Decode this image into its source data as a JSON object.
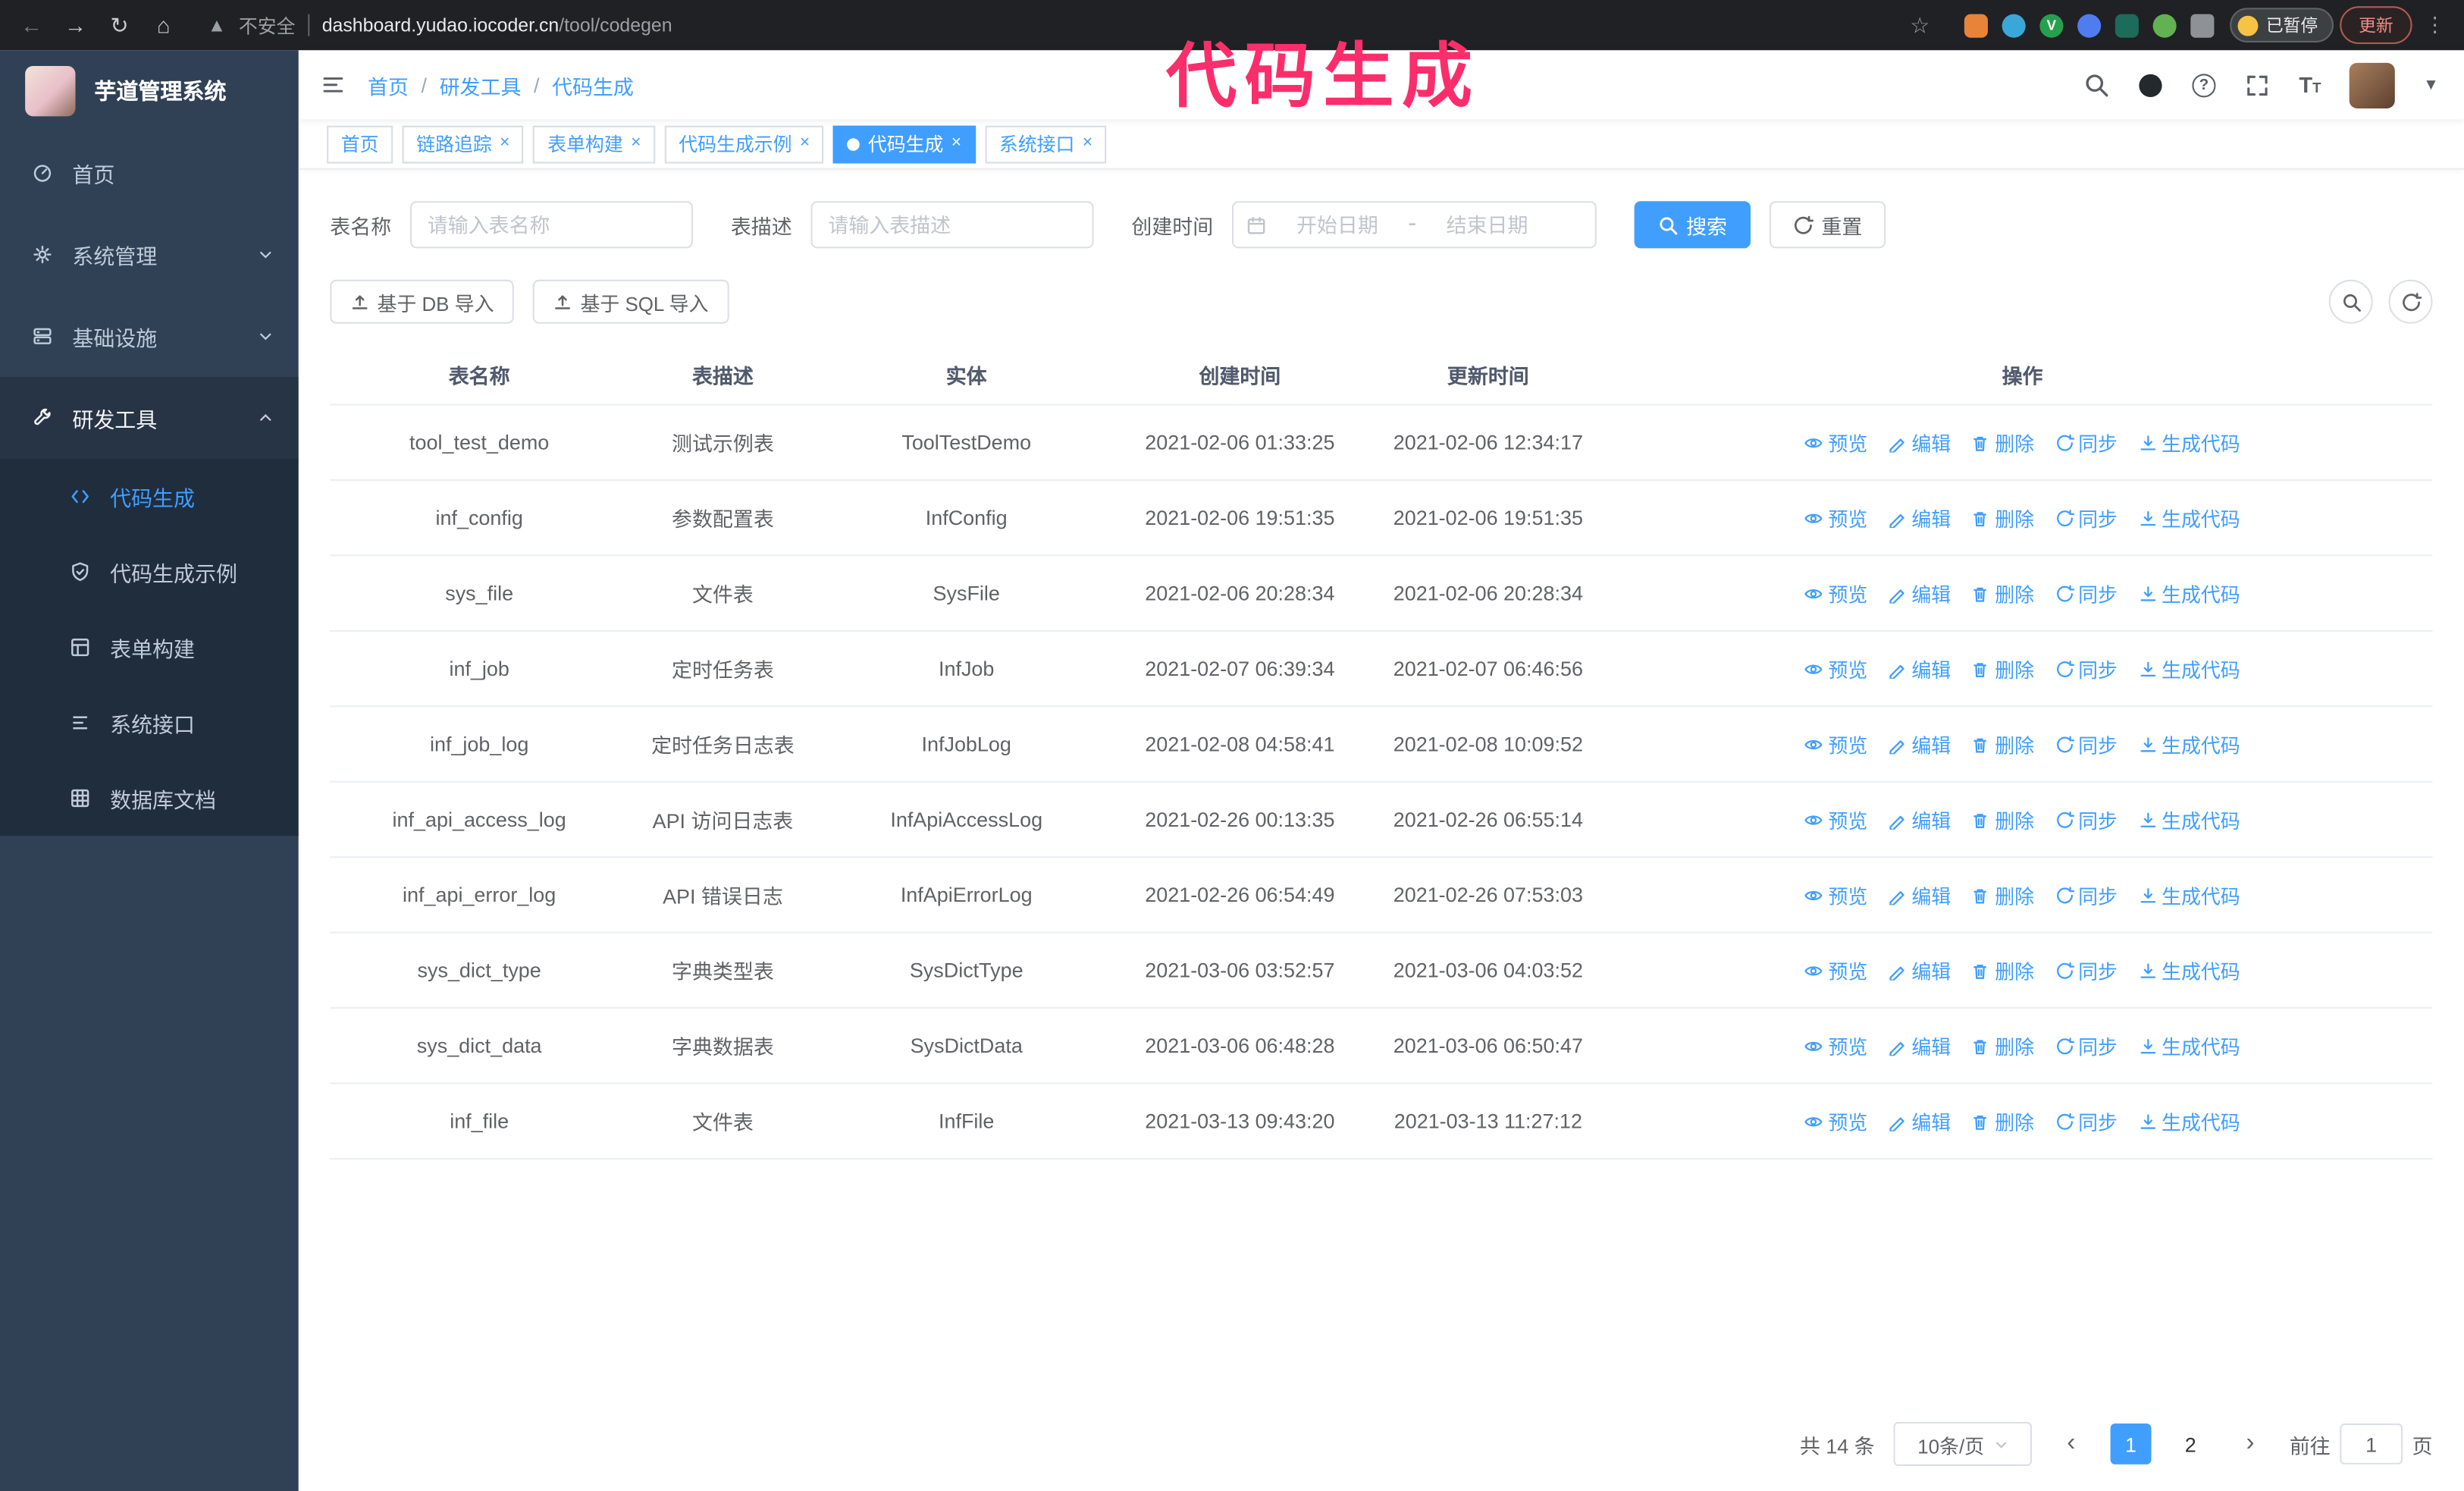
{
  "colors": {
    "accent": "#409eff",
    "sidebar_bg": "#304156",
    "submenu_bg": "#1f2d3d",
    "chrome_bg": "#202124",
    "annotation_pink": "#fb2e6b"
  },
  "annotation": {
    "text": "代码生成"
  },
  "browser": {
    "security_text": "不安全",
    "url_host": "dashboard.yudao.iocoder.cn",
    "url_path": "/tool/codegen",
    "paused_badge": "已暂停",
    "update_button": "更新",
    "extension_v_label": "V"
  },
  "sidebar": {
    "logo_title": "芋道管理系统",
    "items": [
      {
        "label": "首页"
      },
      {
        "label": "系统管理"
      },
      {
        "label": "基础设施"
      },
      {
        "label": "研发工具",
        "expanded": true
      }
    ],
    "submenu": [
      {
        "label": "代码生成",
        "active": true
      },
      {
        "label": "代码生成示例"
      },
      {
        "label": "表单构建"
      },
      {
        "label": "系统接口"
      },
      {
        "label": "数据库文档"
      }
    ]
  },
  "header": {
    "breadcrumb": [
      "首页",
      "研发工具",
      "代码生成"
    ],
    "separator": "/"
  },
  "tabs": [
    {
      "label": "首页",
      "closable": false,
      "active": false
    },
    {
      "label": "链路追踪",
      "closable": true,
      "active": false
    },
    {
      "label": "表单构建",
      "closable": true,
      "active": false
    },
    {
      "label": "代码生成示例",
      "closable": true,
      "active": false
    },
    {
      "label": "代码生成",
      "closable": true,
      "active": true
    },
    {
      "label": "系统接口",
      "closable": true,
      "active": false
    }
  ],
  "filters": {
    "table_name_label": "表名称",
    "table_name_placeholder": "请输入表名称",
    "table_desc_label": "表描述",
    "table_desc_placeholder": "请输入表描述",
    "create_time_label": "创建时间",
    "date_start_placeholder": "开始日期",
    "date_separator": "-",
    "date_end_placeholder": "结束日期",
    "search_button": "搜索",
    "reset_button": "重置"
  },
  "toolbar": {
    "import_db_button": "基于 DB 导入",
    "import_sql_button": "基于 SQL 导入"
  },
  "table": {
    "columns": [
      "表名称",
      "表描述",
      "实体",
      "创建时间",
      "更新时间",
      "操作"
    ],
    "actions": [
      "预览",
      "编辑",
      "删除",
      "同步",
      "生成代码"
    ],
    "rows": [
      {
        "name": "tool_test_demo",
        "desc": "测试示例表",
        "entity": "ToolTestDemo",
        "created": "2021-02-06 01:33:25",
        "updated": "2021-02-06 12:34:17"
      },
      {
        "name": "inf_config",
        "desc": "参数配置表",
        "entity": "InfConfig",
        "created": "2021-02-06 19:51:35",
        "updated": "2021-02-06 19:51:35"
      },
      {
        "name": "sys_file",
        "desc": "文件表",
        "entity": "SysFile",
        "created": "2021-02-06 20:28:34",
        "updated": "2021-02-06 20:28:34"
      },
      {
        "name": "inf_job",
        "desc": "定时任务表",
        "entity": "InfJob",
        "created": "2021-02-07 06:39:34",
        "updated": "2021-02-07 06:46:56"
      },
      {
        "name": "inf_job_log",
        "desc": "定时任务日志表",
        "entity": "InfJobLog",
        "created": "2021-02-08 04:58:41",
        "updated": "2021-02-08 10:09:52"
      },
      {
        "name": "inf_api_access_log",
        "desc": "API 访问日志表",
        "entity": "InfApiAccessLog",
        "created": "2021-02-26 00:13:35",
        "updated": "2021-02-26 06:55:14"
      },
      {
        "name": "inf_api_error_log",
        "desc": "API 错误日志",
        "entity": "InfApiErrorLog",
        "created": "2021-02-26 06:54:49",
        "updated": "2021-02-26 07:53:03"
      },
      {
        "name": "sys_dict_type",
        "desc": "字典类型表",
        "entity": "SysDictType",
        "created": "2021-03-06 03:52:57",
        "updated": "2021-03-06 04:03:52"
      },
      {
        "name": "sys_dict_data",
        "desc": "字典数据表",
        "entity": "SysDictData",
        "created": "2021-03-06 06:48:28",
        "updated": "2021-03-06 06:50:47"
      },
      {
        "name": "inf_file",
        "desc": "文件表",
        "entity": "InfFile",
        "created": "2021-03-13 09:43:20",
        "updated": "2021-03-13 11:27:12"
      }
    ]
  },
  "pagination": {
    "total_text": "共 14 条",
    "page_size": "10条/页",
    "pages": [
      "1",
      "2"
    ],
    "active_page": "1",
    "goto_label": "前往",
    "goto_value": "1",
    "goto_suffix": "页"
  }
}
